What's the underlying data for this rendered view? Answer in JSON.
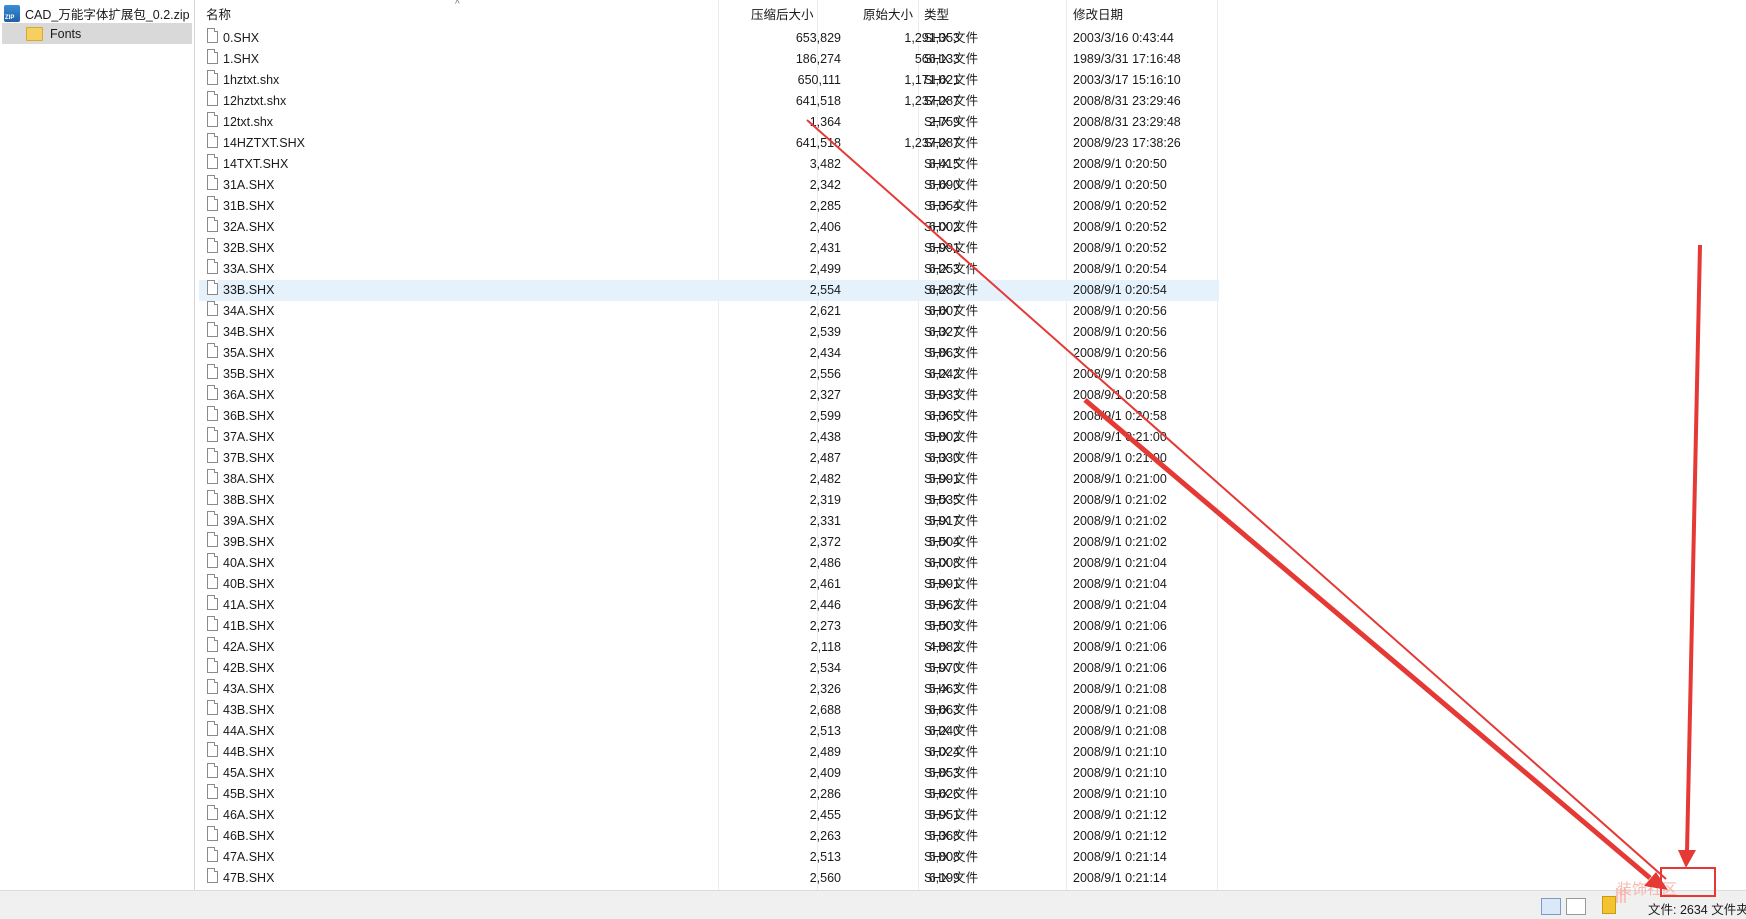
{
  "tree": {
    "root_label": "CAD_万能字体扩展包_0.2.zip",
    "child_label": "Fonts"
  },
  "columns": {
    "name": "名称",
    "compressed": "压缩后大小",
    "original": "原始大小",
    "type": "类型",
    "modified": "修改日期"
  },
  "files": [
    {
      "name": "0.SHX",
      "comp": "653,829",
      "orig": "1,291,353",
      "type": "SHX 文件",
      "date": "2003/3/16 0:43:44"
    },
    {
      "name": "1.SHX",
      "comp": "186,274",
      "orig": "566,133",
      "type": "SHX 文件",
      "date": "1989/3/31 17:16:48"
    },
    {
      "name": "1hztxt.shx",
      "comp": "650,111",
      "orig": "1,171,621",
      "type": "SHX 文件",
      "date": "2003/3/17 15:16:10"
    },
    {
      "name": "12hztxt.shx",
      "comp": "641,518",
      "orig": "1,237,287",
      "type": "SHX 文件",
      "date": "2008/8/31 23:29:46"
    },
    {
      "name": "12txt.shx",
      "comp": "1,364",
      "orig": "2,759",
      "type": "SHX 文件",
      "date": "2008/8/31 23:29:48"
    },
    {
      "name": "14HZTXT.SHX",
      "comp": "641,518",
      "orig": "1,237,287",
      "type": "SHX 文件",
      "date": "2008/9/23 17:38:26"
    },
    {
      "name": "14TXT.SHX",
      "comp": "3,482",
      "orig": "8,415",
      "type": "SHX 文件",
      "date": "2008/9/1 0:20:50"
    },
    {
      "name": "31A.SHX",
      "comp": "2,342",
      "orig": "5,690",
      "type": "SHX 文件",
      "date": "2008/9/1 0:20:50"
    },
    {
      "name": "31B.SHX",
      "comp": "2,285",
      "orig": "5,354",
      "type": "SHX 文件",
      "date": "2008/9/1 0:20:52"
    },
    {
      "name": "32A.SHX",
      "comp": "2,406",
      "orig": "6,002",
      "type": "SHX 文件",
      "date": "2008/9/1 0:20:52"
    },
    {
      "name": "32B.SHX",
      "comp": "2,431",
      "orig": "5,991",
      "type": "SHX 文件",
      "date": "2008/9/1 0:20:52"
    },
    {
      "name": "33A.SHX",
      "comp": "2,499",
      "orig": "6,253",
      "type": "SHX 文件",
      "date": "2008/9/1 0:20:54"
    },
    {
      "name": "33B.SHX",
      "comp": "2,554",
      "orig": "6,282",
      "type": "SHX 文件",
      "date": "2008/9/1 0:20:54",
      "selected": true
    },
    {
      "name": "34A.SHX",
      "comp": "2,621",
      "orig": "6,607",
      "type": "SHX 文件",
      "date": "2008/9/1 0:20:56"
    },
    {
      "name": "34B.SHX",
      "comp": "2,539",
      "orig": "6,327",
      "type": "SHX 文件",
      "date": "2008/9/1 0:20:56"
    },
    {
      "name": "35A.SHX",
      "comp": "2,434",
      "orig": "5,863",
      "type": "SHX 文件",
      "date": "2008/9/1 0:20:56"
    },
    {
      "name": "35B.SHX",
      "comp": "2,556",
      "orig": "6,242",
      "type": "SHX 文件",
      "date": "2008/9/1 0:20:58"
    },
    {
      "name": "36A.SHX",
      "comp": "2,327",
      "orig": "5,933",
      "type": "SHX 文件",
      "date": "2008/9/1 0:20:58"
    },
    {
      "name": "36B.SHX",
      "comp": "2,599",
      "orig": "6,365",
      "type": "SHX 文件",
      "date": "2008/9/1 0:20:58"
    },
    {
      "name": "37A.SHX",
      "comp": "2,438",
      "orig": "5,802",
      "type": "SHX 文件",
      "date": "2008/9/1 0:21:00"
    },
    {
      "name": "37B.SHX",
      "comp": "2,487",
      "orig": "6,330",
      "type": "SHX 文件",
      "date": "2008/9/1 0:21:00"
    },
    {
      "name": "38A.SHX",
      "comp": "2,482",
      "orig": "5,991",
      "type": "SHX 文件",
      "date": "2008/9/1 0:21:00"
    },
    {
      "name": "38B.SHX",
      "comp": "2,319",
      "orig": "5,535",
      "type": "SHX 文件",
      "date": "2008/9/1 0:21:02"
    },
    {
      "name": "39A.SHX",
      "comp": "2,331",
      "orig": "5,917",
      "type": "SHX 文件",
      "date": "2008/9/1 0:21:02"
    },
    {
      "name": "39B.SHX",
      "comp": "2,372",
      "orig": "5,504",
      "type": "SHX 文件",
      "date": "2008/9/1 0:21:02"
    },
    {
      "name": "40A.SHX",
      "comp": "2,486",
      "orig": "6,008",
      "type": "SHX 文件",
      "date": "2008/9/1 0:21:04"
    },
    {
      "name": "40B.SHX",
      "comp": "2,461",
      "orig": "5,991",
      "type": "SHX 文件",
      "date": "2008/9/1 0:21:04"
    },
    {
      "name": "41A.SHX",
      "comp": "2,446",
      "orig": "5,962",
      "type": "SHX 文件",
      "date": "2008/9/1 0:21:04"
    },
    {
      "name": "41B.SHX",
      "comp": "2,273",
      "orig": "5,503",
      "type": "SHX 文件",
      "date": "2008/9/1 0:21:06"
    },
    {
      "name": "42A.SHX",
      "comp": "2,118",
      "orig": "4,882",
      "type": "SHX 文件",
      "date": "2008/9/1 0:21:06"
    },
    {
      "name": "42B.SHX",
      "comp": "2,534",
      "orig": "5,970",
      "type": "SHX 文件",
      "date": "2008/9/1 0:21:06"
    },
    {
      "name": "43A.SHX",
      "comp": "2,326",
      "orig": "5,463",
      "type": "SHX 文件",
      "date": "2008/9/1 0:21:08"
    },
    {
      "name": "43B.SHX",
      "comp": "2,688",
      "orig": "6,663",
      "type": "SHX 文件",
      "date": "2008/9/1 0:21:08"
    },
    {
      "name": "44A.SHX",
      "comp": "2,513",
      "orig": "6,240",
      "type": "SHX 文件",
      "date": "2008/9/1 0:21:08"
    },
    {
      "name": "44B.SHX",
      "comp": "2,489",
      "orig": "6,024",
      "type": "SHX 文件",
      "date": "2008/9/1 0:21:10"
    },
    {
      "name": "45A.SHX",
      "comp": "2,409",
      "orig": "5,853",
      "type": "SHX 文件",
      "date": "2008/9/1 0:21:10"
    },
    {
      "name": "45B.SHX",
      "comp": "2,286",
      "orig": "5,626",
      "type": "SHX 文件",
      "date": "2008/9/1 0:21:10"
    },
    {
      "name": "46A.SHX",
      "comp": "2,455",
      "orig": "5,951",
      "type": "SHX 文件",
      "date": "2008/9/1 0:21:12"
    },
    {
      "name": "46B.SHX",
      "comp": "2,263",
      "orig": "5,368",
      "type": "SHX 文件",
      "date": "2008/9/1 0:21:12"
    },
    {
      "name": "47A.SHX",
      "comp": "2,513",
      "orig": "5,808",
      "type": "SHX 文件",
      "date": "2008/9/1 0:21:14"
    },
    {
      "name": "47B.SHX",
      "comp": "2,560",
      "orig": "6,199",
      "type": "SHX 文件",
      "date": "2008/9/1 0:21:14"
    }
  ],
  "status": {
    "info": "文件: 2634 文件夹"
  },
  "watermark": "装饰社区",
  "colors": {
    "selected_row": "#e5f1fb",
    "annotation": "#e53935"
  },
  "icons": [
    "zip-icon",
    "folder-icon",
    "file-icon",
    "details-view-icon",
    "thumbnail-view-icon",
    "lock-icon"
  ]
}
